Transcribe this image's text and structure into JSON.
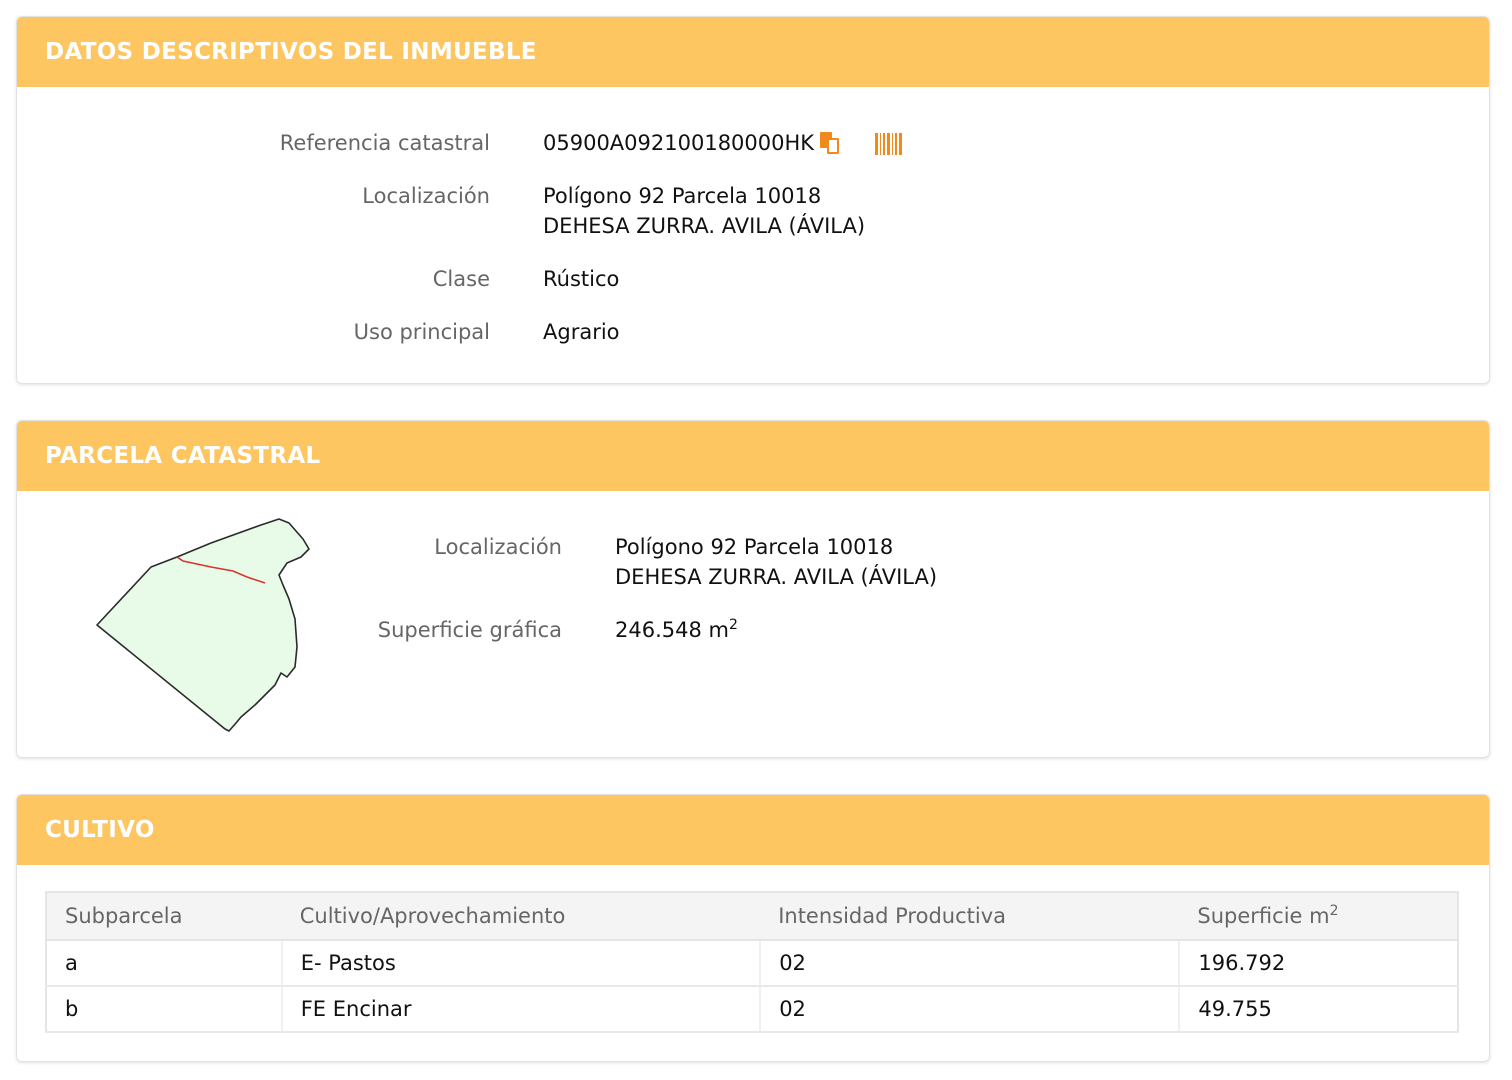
{
  "colors": {
    "header_bg": "#fdc660",
    "header_text": "#ffffff",
    "icon_accent": "#f08a1c",
    "parcel_fill": "#e8fbe8",
    "subparcel_line": "#d9342b"
  },
  "datos": {
    "title": "DATOS DESCRIPTIVOS DEL INMUEBLE",
    "referencia_label": "Referencia catastral",
    "referencia_value": "05900A092100180000HK",
    "copy_icon": "copy-icon",
    "barcode_icon": "barcode-icon",
    "localizacion_label": "Localización",
    "localizacion_line1": "Polígono 92 Parcela 10018",
    "localizacion_line2": "DEHESA ZURRA. AVILA (ÁVILA)",
    "clase_label": "Clase",
    "clase_value": "Rústico",
    "uso_label": "Uso principal",
    "uso_value": "Agrario"
  },
  "parcela": {
    "title": "PARCELA CATASTRAL",
    "localizacion_label": "Localización",
    "localizacion_line1": "Polígono 92 Parcela 10018",
    "localizacion_line2": "DEHESA ZURRA. AVILA (ÁVILA)",
    "superficie_label": "Superficie gráfica",
    "superficie_value": "246.548 m",
    "superficie_unit_sup": "2"
  },
  "cultivo": {
    "title": "CULTIVO",
    "headers": [
      "Subparcela",
      "Cultivo/Aprovechamiento",
      "Intensidad Productiva",
      "Superficie m"
    ],
    "header_sup": "2",
    "rows": [
      [
        "a",
        "E- Pastos",
        "02",
        "196.792"
      ],
      [
        "b",
        "FE Encinar",
        "02",
        "49.755"
      ]
    ]
  }
}
